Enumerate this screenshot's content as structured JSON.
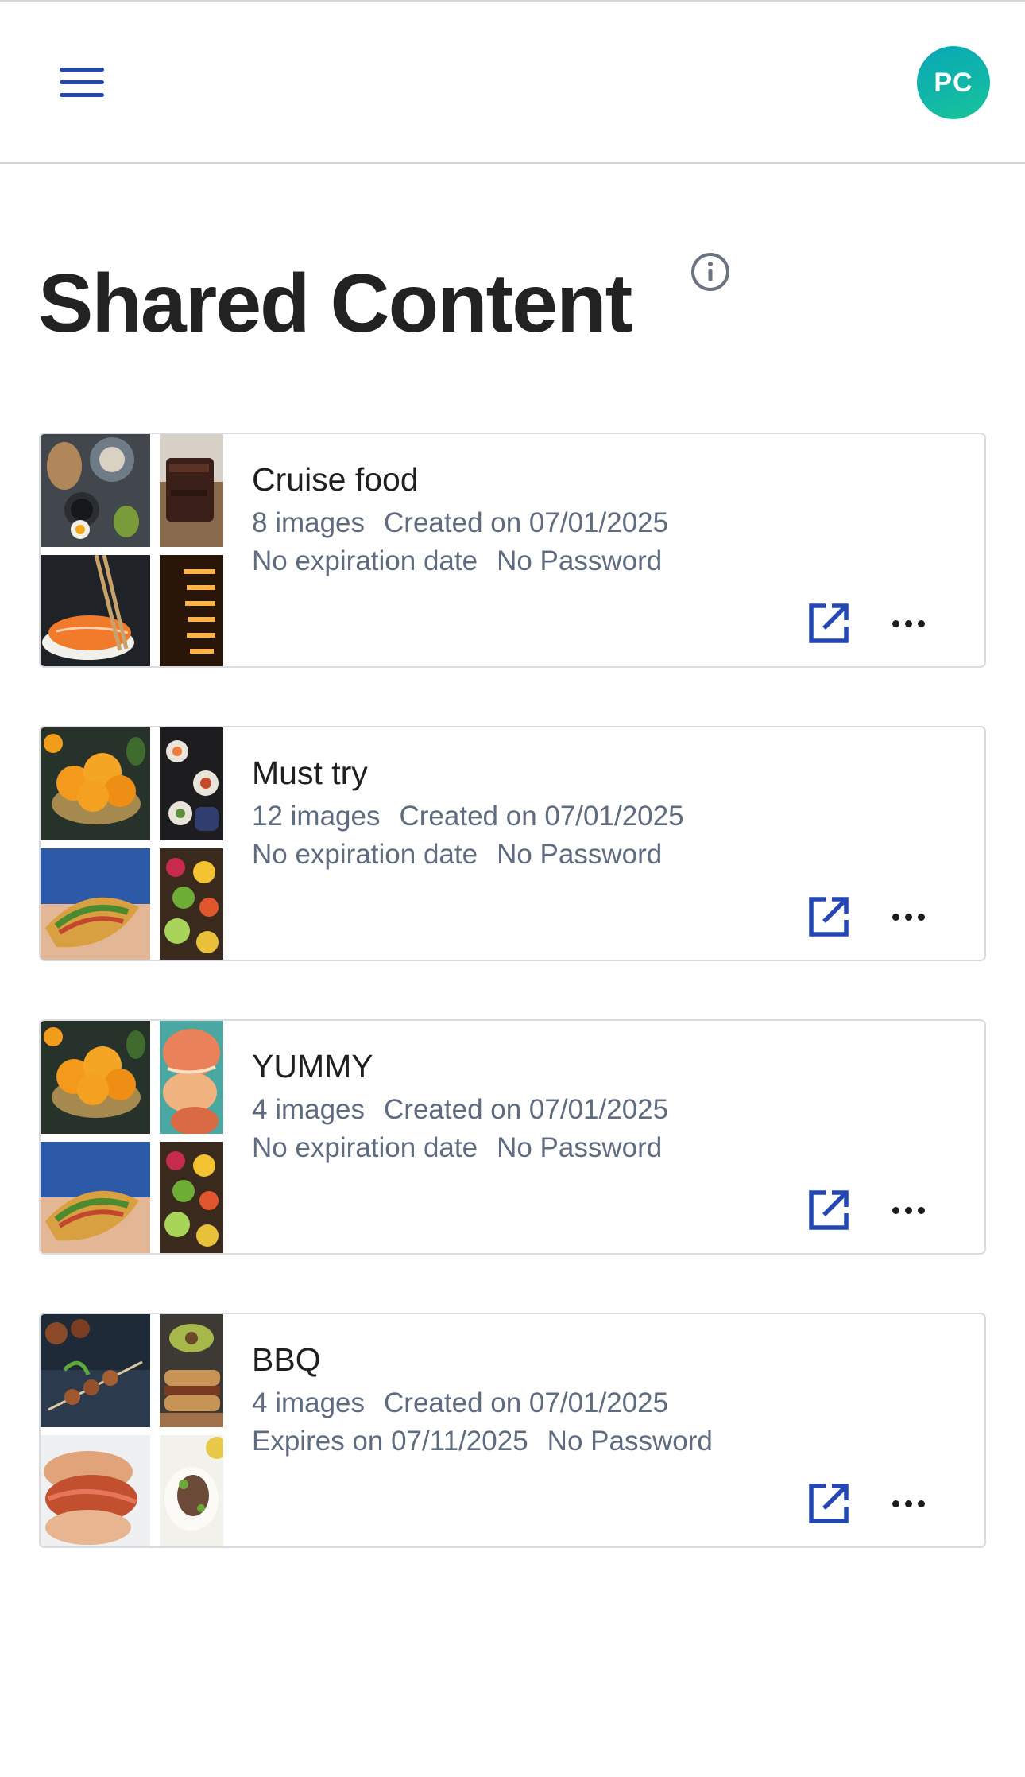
{
  "header": {
    "menu_icon": "hamburger-menu-icon",
    "avatar_initials": "PC",
    "avatar_colors": [
      "#0aa7b8",
      "#19c59a"
    ]
  },
  "page": {
    "title": "Shared Content",
    "info_icon": "info-icon"
  },
  "colors": {
    "accent": "#2447b4",
    "meta_text": "#5f6b7e",
    "card_border": "#d9dbde"
  },
  "cards": [
    {
      "title": "Cruise food",
      "image_count": "8 images",
      "created": "Created on 07/01/2025",
      "expiration": "No expiration date",
      "password": "No Password",
      "thumbnails": [
        "breakfast-table-photo",
        "chocolate-cake-photo",
        "salmon-sushi-photo",
        "neon-sign-photo"
      ]
    },
    {
      "title": "Must try",
      "image_count": "12 images",
      "created": "Created on 07/01/2025",
      "expiration": "No expiration date",
      "password": "No Password",
      "thumbnails": [
        "tangerines-bowl-photo",
        "sushi-rolls-photo",
        "taco-hands-photo",
        "fruit-platter-photo"
      ]
    },
    {
      "title": "YUMMY",
      "image_count": "4 images",
      "created": "Created on 07/01/2025",
      "expiration": "No expiration date",
      "password": "No Password",
      "thumbnails": [
        "tangerines-bowl-photo",
        "seafood-plate-photo",
        "taco-hands-photo",
        "fruit-platter-photo"
      ]
    },
    {
      "title": "BBQ",
      "image_count": "4 images",
      "created": "Created on 07/01/2025",
      "expiration": "Expires on 07/11/2025",
      "password": "No Password",
      "thumbnails": [
        "skewers-grill-photo",
        "avocado-sandwich-photo",
        "pulled-pork-bun-photo",
        "plated-dish-photo"
      ]
    }
  ]
}
